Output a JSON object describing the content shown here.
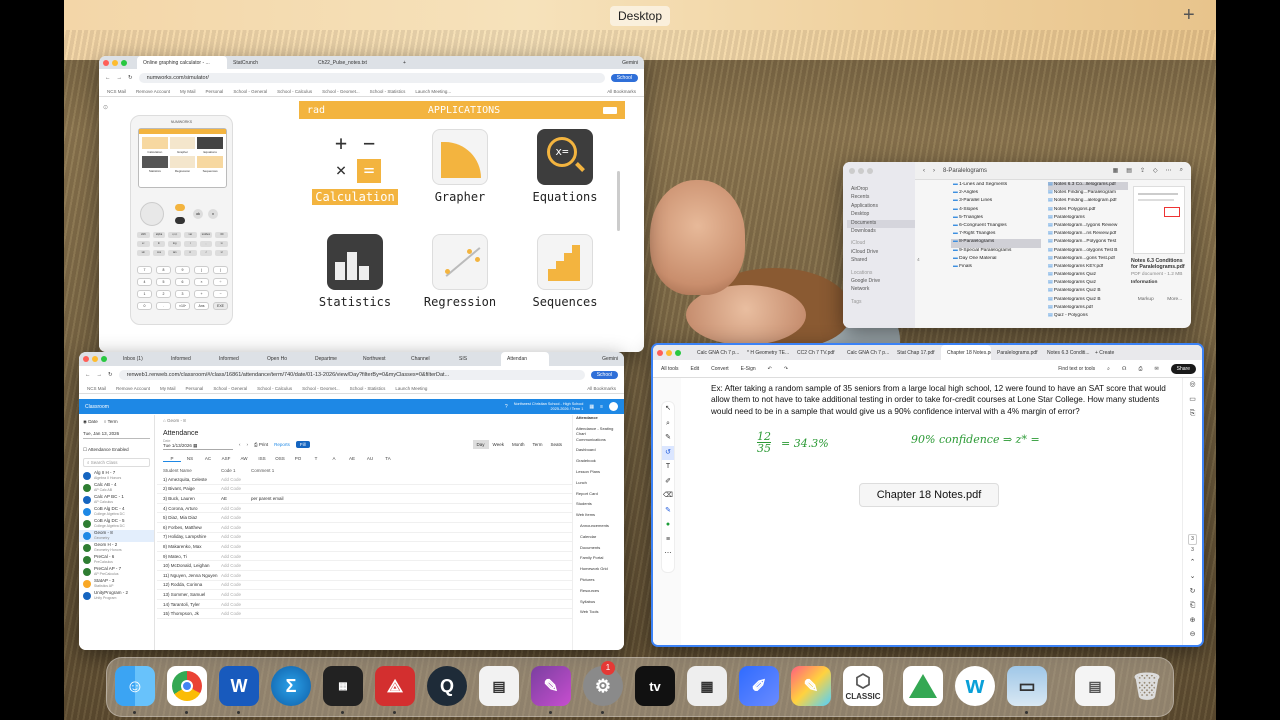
{
  "desktop": {
    "title": "Desktop"
  },
  "calc_window": {
    "tabs": [
      "Online graphing calculator - ...",
      "StatCrunch",
      "Ch22_Pulse_notes.txt"
    ],
    "gemini": "Gemini",
    "url": "numworks.com/simulator/",
    "school": "School",
    "bookmarks": [
      "NCS Mail",
      "Remove Account",
      "My Mail",
      "Personal",
      "School - General",
      "School - Calculus",
      "School - Geomet...",
      "School - Statistics",
      "Launch Meeting..."
    ],
    "all_bookmarks": "All Bookmarks",
    "brand": "NUMWORKS",
    "mode": "rad",
    "header": "APPLICATIONS",
    "apps": [
      "Calculation",
      "Grapher",
      "Equations",
      "Statistics",
      "Regression",
      "Sequences"
    ],
    "screen_apps": [
      "Calculation",
      "Grapher",
      "Equations",
      "Statistics",
      "Regression",
      "Sequences"
    ],
    "keys": [
      "ok",
      "x",
      "shift",
      "alpha",
      "x,n,t",
      "var",
      "toolbox",
      "⌫",
      "eˣ",
      "ln",
      "log",
      "i",
      ",",
      "xʸ",
      "sin",
      "cos",
      "tan",
      "π",
      "√",
      "x²",
      "7",
      "8",
      "9",
      "(",
      ")",
      "4",
      "5",
      "6",
      "×",
      "÷",
      "1",
      "2",
      "3",
      "+",
      "−",
      "0",
      ".",
      "×10ˣ",
      "Ans",
      "EXE"
    ]
  },
  "attendance_window": {
    "tabs": [
      "Inbox (1)",
      "Informed",
      "Informed",
      "Open Ho",
      "Departme",
      "Northwest",
      "Channel",
      "SIS",
      "Attendan"
    ],
    "gemini": "Gemini",
    "url": "renweb1.renweb.com/classroom/#/class/16861/attendance/term/740/date/01-13-2026/view/Day?filterBy=0&myClasses=0&filterDat...",
    "school": "School",
    "bookmarks": [
      "NCS Mail",
      "Remove Account",
      "My Mail",
      "Personal",
      "School - General",
      "School - Calculus",
      "School - Geomet...",
      "School - Statistics",
      "Launch Meeting"
    ],
    "all_bookmarks": "All Bookmarks",
    "app_title": "Classroom",
    "school_name": "Northwest Christian School - High School",
    "school_year": "2025-2026 / Term 1",
    "radio": [
      "Date",
      "Term"
    ],
    "date_value": "Tue, Jan 13, 2026",
    "enabled": "Attendance Enabled",
    "search": "Search Class",
    "classes": [
      {
        "name": "Alg II H - 7",
        "sub": "Algebra II Honors",
        "color": "#1565c0"
      },
      {
        "name": "Calc AB - 4",
        "sub": "AP Calc AB",
        "color": "#2e7d32"
      },
      {
        "name": "Calc AP BC - 1",
        "sub": "AP Calculus",
        "color": "#1565c0"
      },
      {
        "name": "CoB Alg DC - 4",
        "sub": "College Algebra DC",
        "color": "#1e88e5"
      },
      {
        "name": "CoB Alg DC - 5",
        "sub": "College Algebra DC",
        "color": "#2e7d32"
      },
      {
        "name": "Geom - 8",
        "sub": "Geometry",
        "color": "#1e88e5"
      },
      {
        "name": "Geom H - 2",
        "sub": "Geometry Honors",
        "color": "#2e7d32"
      },
      {
        "name": "PreCal - 6",
        "sub": "PreCalculus",
        "color": "#2e7d32"
      },
      {
        "name": "PreCal AP - 7",
        "sub": "AP PreCalculus",
        "color": "#2e7d32"
      },
      {
        "name": "StatAP - 3",
        "sub": "Statistics AP",
        "color": "#f9a825"
      },
      {
        "name": "UnityProgram - 2",
        "sub": "Unity Program",
        "color": "#1565c0"
      }
    ],
    "class_selected": "Geom - 8",
    "heading": "Attendance",
    "date_small": "Date",
    "date_field": "Tue 1/13/2026",
    "print": "Print",
    "reports": "Reports",
    "fill": "Fill",
    "view_tabs": [
      "Day",
      "Week",
      "Month",
      "Term",
      "Seats"
    ],
    "codes": [
      "P",
      "NS",
      "AC",
      "ASF",
      "AW",
      "ISS",
      "OSS",
      "PO",
      "T",
      "A",
      "AE",
      "AU",
      "TA"
    ],
    "cols": [
      "Student Name",
      "Code 1",
      "Comment 1"
    ],
    "students": [
      {
        "name": "1) Amezquita, Celeste",
        "code": "Add Code",
        "comment": ""
      },
      {
        "name": "2) Bivant, Paige",
        "code": "Add Code",
        "comment": ""
      },
      {
        "name": "3) Buck, Lauren",
        "code": "AE",
        "comment": "per parent email"
      },
      {
        "name": "4) Corona, Arturo",
        "code": "Add Code",
        "comment": ""
      },
      {
        "name": "5) Diaz, Mia Diaz",
        "code": "Add Code",
        "comment": ""
      },
      {
        "name": "6) Forbes, Matthew",
        "code": "Add Code",
        "comment": ""
      },
      {
        "name": "7) Holiday, Lampshire",
        "code": "Add Code",
        "comment": ""
      },
      {
        "name": "8) Makarenko, Max",
        "code": "Add Code",
        "comment": ""
      },
      {
        "name": "9) Mateo, Ti",
        "code": "Add Code",
        "comment": ""
      },
      {
        "name": "10) McDonald, Leighan",
        "code": "Add Code",
        "comment": ""
      },
      {
        "name": "11) Nguyen, Jenna Nguyen",
        "code": "Add Code",
        "comment": ""
      },
      {
        "name": "12) Rodda, Corinna",
        "code": "Add Code",
        "comment": ""
      },
      {
        "name": "13) Sommer, Samuel",
        "code": "Add Code",
        "comment": ""
      },
      {
        "name": "14) Tarantoli, Tyler",
        "code": "Add Code",
        "comment": ""
      },
      {
        "name": "15) Thompson, Jk",
        "code": "Add Code",
        "comment": ""
      }
    ],
    "menu": [
      "Attendance",
      "Attendance - Seating Chart",
      "Communications",
      "Dashboard",
      "Gradebook",
      "Lesson Plans",
      "Lunch",
      "Report Card",
      "Students",
      "Web Items",
      "Announcements",
      "Calendar",
      "Documents",
      "Family Portal",
      "Homework Grid",
      "Pictures",
      "Resources",
      "Syllabus",
      "Web Tools"
    ]
  },
  "finder_window": {
    "title": "8-Paralelograms",
    "sidebar": [
      "AirDrop",
      "Recents",
      "Applications",
      "Desktop",
      "Documents",
      "Downloads",
      "iCloud",
      "iCloud Drive",
      "Shared",
      "Locations",
      "Google Drive",
      "Network",
      "Tags"
    ],
    "col1": [
      "1-Lines and Segments",
      "2-Angles",
      "3-Parallel Lines",
      "4-Slopes",
      "5-Triangles",
      "6-Congruent Triangles",
      "7-Right Triangles",
      "8-Paralelograms",
      "9-Special Paralelograms",
      "Day One Material",
      "Finals"
    ],
    "col1_selected": "8-Paralelograms",
    "col2": [
      "Notes 6.3 Co...llelograms.pdf",
      "Notes Finding...Paralelogram",
      "Notes Finding...alelogram.pdf",
      "Notes Polygons.pdf",
      "Paralelograms",
      "Paralelogram...lygons Review",
      "Paralelogram...ns Review.pdf",
      "Paralelogram...Polygons Test",
      "Paralelogram...olygons Test B",
      "Paralelogram...gons Test.pdf",
      "Paralelograms KEY.pdf",
      "Paralelograms Quiz",
      "Paralelograms Quiz",
      "Paralelograms Quiz B",
      "Paralelograms Quiz B",
      "Paralelograms.pdf",
      "Quiz - Polygons"
    ],
    "preview_title": "Notes 6.3 Conditions for Paralelograms.pdf",
    "preview_meta": "PDF document - 1.2 MB",
    "preview_info": "Information",
    "preview_buttons": [
      "Markup",
      "More..."
    ]
  },
  "pdf_window": {
    "tabs": [
      "Calc GNA Ch 7 p...",
      "* H Geometry TE...",
      "CC2 Ch 7 TV.pdf",
      "Calc GNA Ch 7 p...",
      "Stat Chap 17.pdf",
      "Chapter 18 Notes.pdf",
      "Paralelograms.pdf",
      "Notes 6.3 Conditi..."
    ],
    "new_tab": "+ Create",
    "menu": [
      "All tools",
      "Edit",
      "Convert",
      "E-Sign"
    ],
    "find": "Find text or tools",
    "share": "Share",
    "question": "Ex:  After taking a random sample of 35 seniors from a large local high school, 12 were found to have an SAT score that would allow them to not have to take additional testing in order to take for-credit courses at Lone Star College.  How many students would need to be in a sample that would give us a 90% confidence interval with a 4% margin of error?",
    "hw_frac_num": "12",
    "hw_frac_den": "35",
    "hw_result": "= 34.3%",
    "hw_conf": "90% confidence ⇒ z* =",
    "doc_label": "Chapter 18 Notes.pdf",
    "page_num": "3",
    "page_total": "3"
  },
  "dock": {
    "badge": "1",
    "geogebra_label": "CLASSIC"
  }
}
